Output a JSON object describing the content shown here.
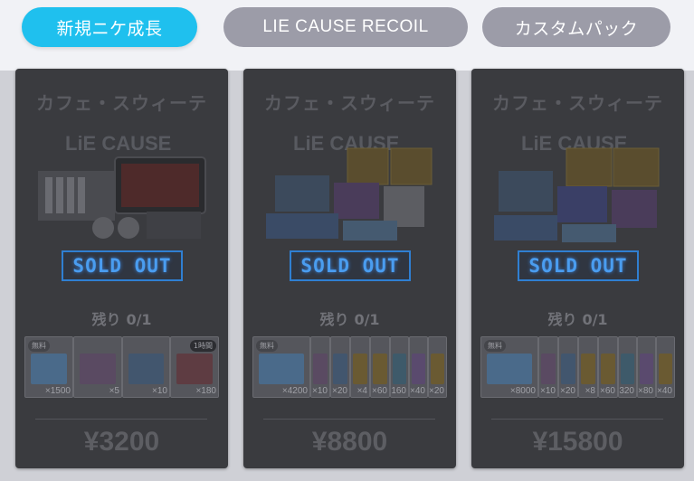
{
  "tabs": [
    {
      "label": "新規ニケ成長",
      "active": true
    },
    {
      "label": "LIE CAUSE RECOIL",
      "active": false
    },
    {
      "label": "カスタムパック",
      "active": false
    }
  ],
  "packs": [
    {
      "title": "カフェ・スウィーテ",
      "status": "SOLD OUT",
      "remaining_label": "残り",
      "remaining_value": "0/1",
      "items": [
        {
          "tag": "無料",
          "qty": "×1500"
        },
        {
          "tag": "",
          "qty": "×5"
        },
        {
          "tag": "",
          "qty": "×10"
        },
        {
          "tag": "1時間",
          "qty": "×180"
        }
      ],
      "price": "¥3200"
    },
    {
      "title": "カフェ・スウィーテ",
      "status": "SOLD OUT",
      "remaining_label": "残り",
      "remaining_value": "0/1",
      "items": [
        {
          "tag": "無料",
          "qty": "×4200"
        },
        {
          "tag": "",
          "qty": "×10"
        },
        {
          "tag": "",
          "qty": "×20"
        },
        {
          "tag": "",
          "qty": "×4"
        },
        {
          "tag": "",
          "qty": "×60"
        },
        {
          "tag": "",
          "qty": "160"
        },
        {
          "tag": "",
          "qty": "×40"
        },
        {
          "tag": "",
          "qty": "×20"
        }
      ],
      "price": "¥8800"
    },
    {
      "title": "カフェ・スウィーテ",
      "status": "SOLD OUT",
      "remaining_label": "残り",
      "remaining_value": "0/1",
      "items": [
        {
          "tag": "無料",
          "qty": "×8000"
        },
        {
          "tag": "",
          "qty": "×10"
        },
        {
          "tag": "",
          "qty": "×20"
        },
        {
          "tag": "",
          "qty": "×8"
        },
        {
          "tag": "",
          "qty": "×60"
        },
        {
          "tag": "",
          "qty": "320"
        },
        {
          "tag": "",
          "qty": "×80"
        },
        {
          "tag": "",
          "qty": "×40"
        }
      ],
      "price": "¥15800"
    }
  ],
  "colors": {
    "active_tab": "#1fc0ee",
    "inactive_tab": "#9c9ca8",
    "sold_out": "#2f7fd2"
  }
}
